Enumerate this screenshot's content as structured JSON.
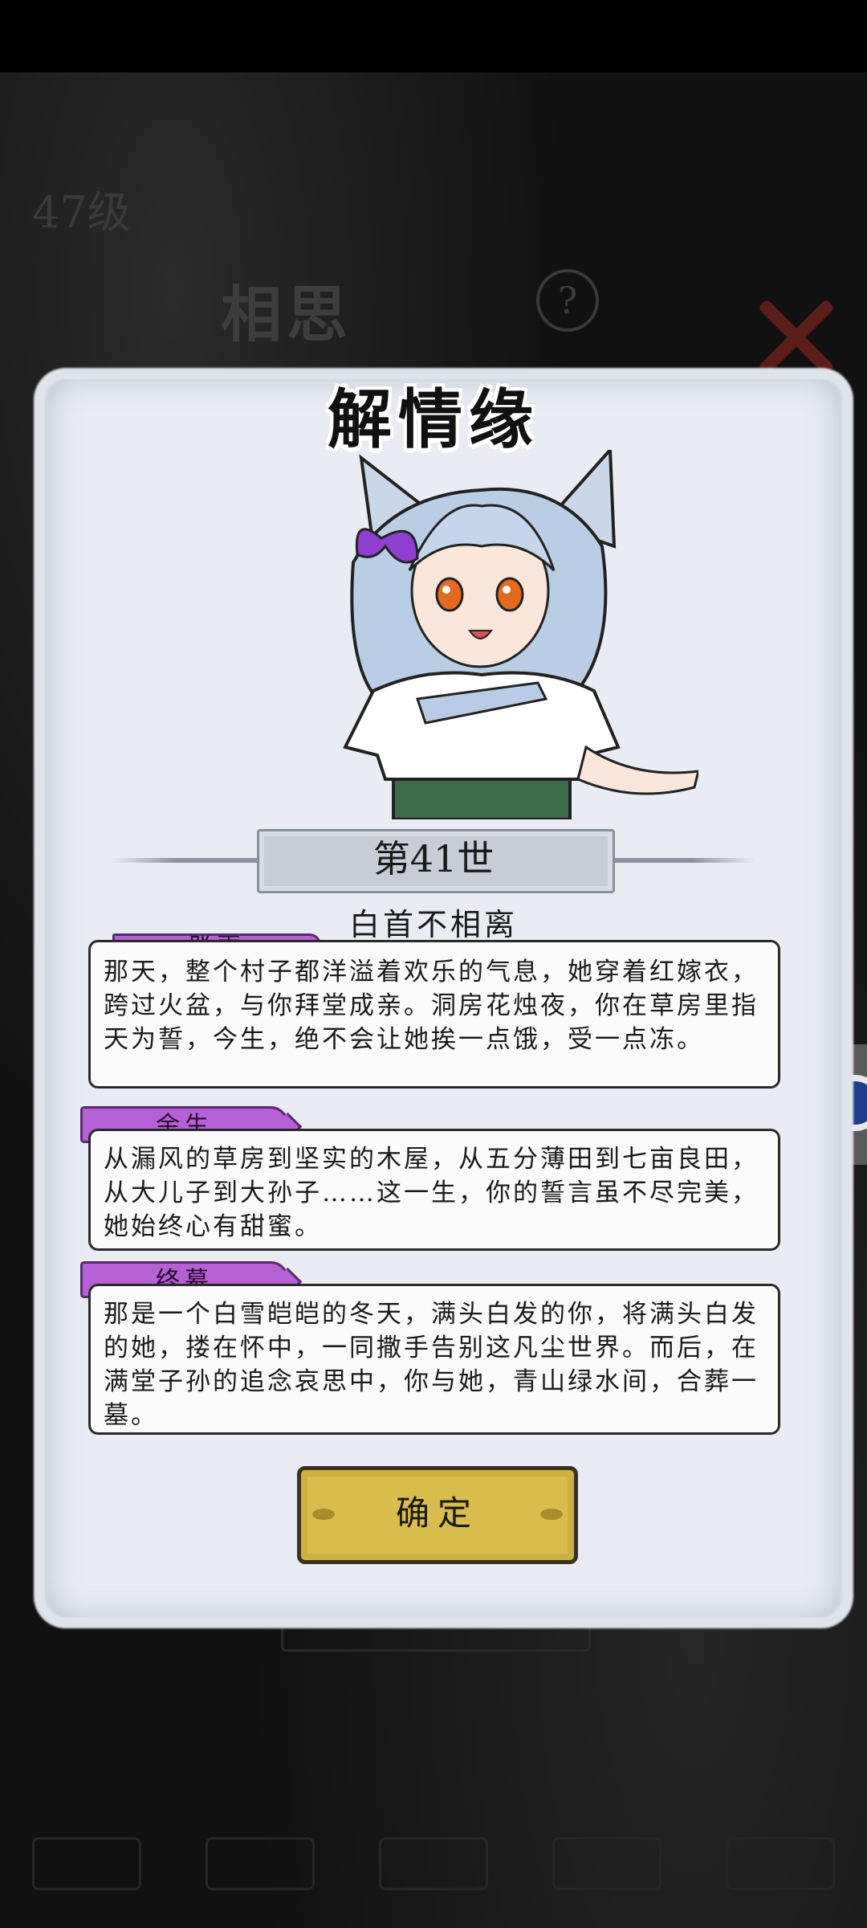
{
  "background": {
    "level": "47级",
    "section_title": "相思",
    "help_symbol": "?"
  },
  "dialog": {
    "title": "解情缘",
    "generation": "第41世",
    "subtitle": "白首不相离",
    "sections": [
      {
        "tag": "成亲",
        "text": "那天，整个村子都洋溢着欢乐的气息，她穿着红嫁衣，跨过火盆，与你拜堂成亲。洞房花烛夜，你在草房里指天为誓，今生，绝不会让她挨一点饿，受一点冻。"
      },
      {
        "tag": "余生",
        "text": "从漏风的草房到坚实的木屋，从五分薄田到七亩良田，从大儿子到大孙子……这一生，你的誓言虽不尽完美，她始终心有甜蜜。"
      },
      {
        "tag": "终幕",
        "text": "那是一个白雪皑皑的冬天，满头白发的你，将满头白发的她，搂在怀中，一同撒手告别这凡尘世界。而后，在满堂子孙的追念哀思中，你与她，青山绿水间，合葬一墓。"
      }
    ],
    "confirm_label": "确定"
  },
  "colors": {
    "tag": "#b560d4",
    "confirm": "#d9bd4c",
    "paper": "#e9ecf2"
  }
}
